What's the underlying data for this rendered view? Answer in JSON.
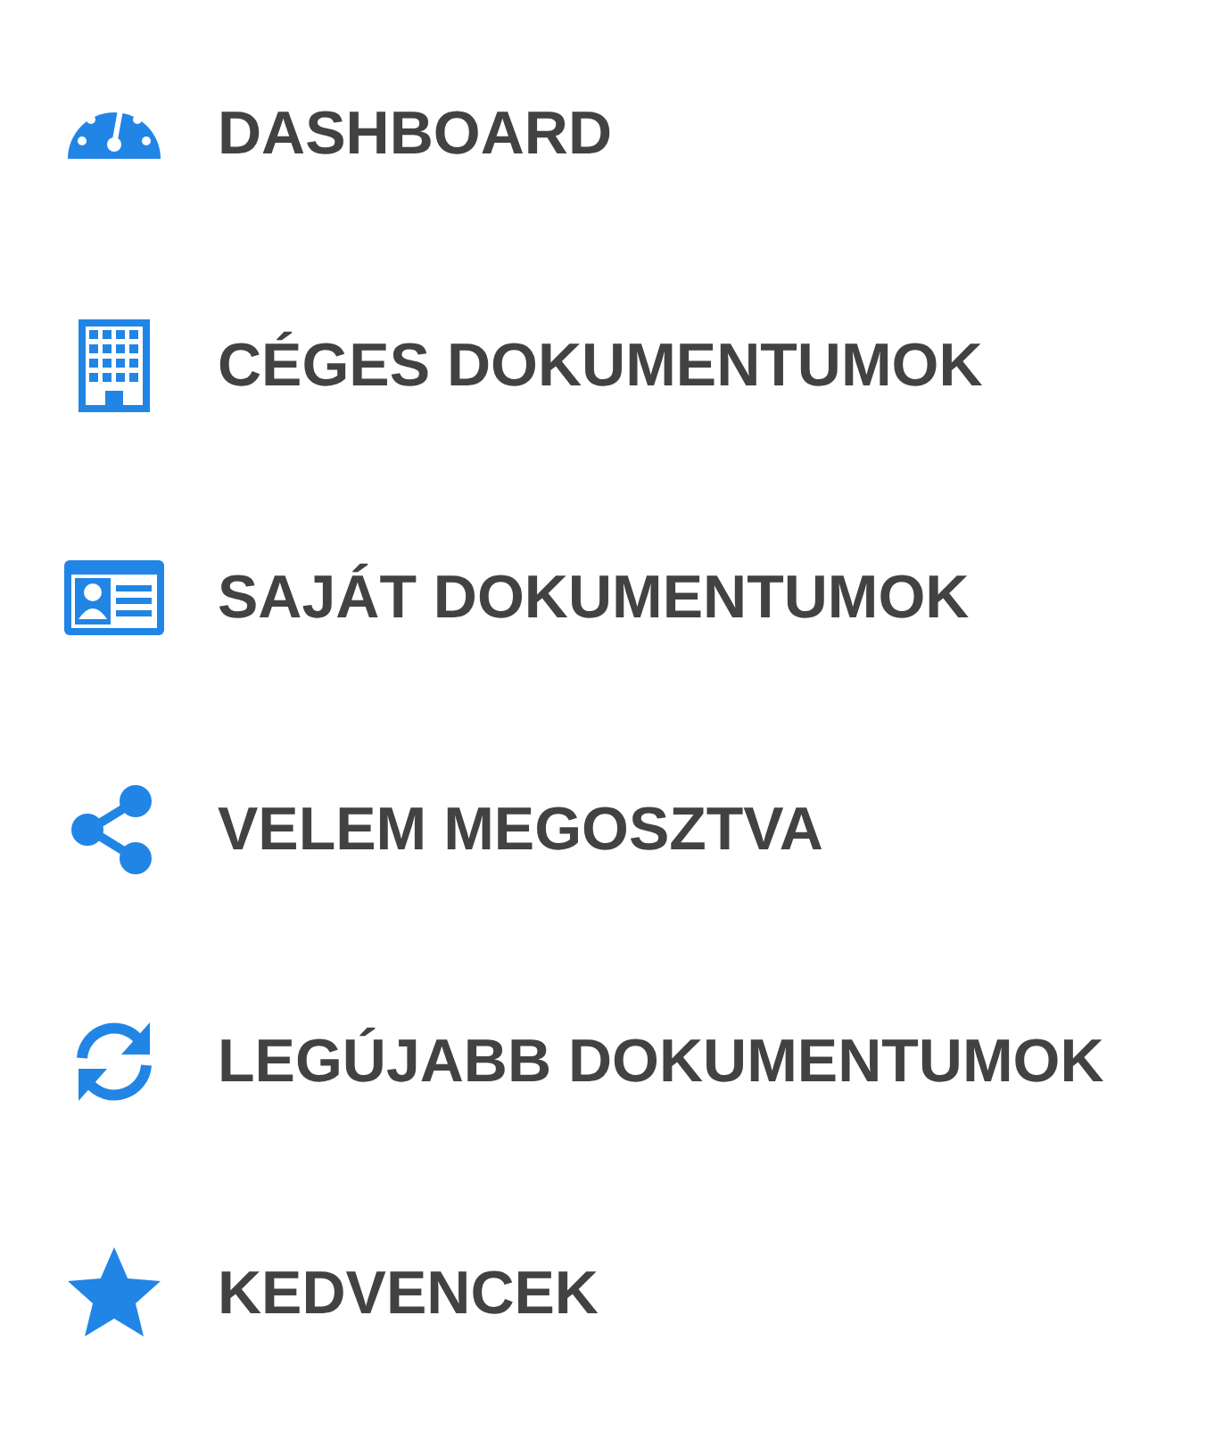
{
  "menu": {
    "items": [
      {
        "label": "DASHBOARD"
      },
      {
        "label": "CÉGES DOKUMENTUMOK"
      },
      {
        "label": "SAJÁT DOKUMENTUMOK"
      },
      {
        "label": "VELEM MEGOSZTVA"
      },
      {
        "label": "LEGÚJABB DOKUMENTUMOK"
      },
      {
        "label": "KEDVENCEK"
      }
    ]
  }
}
